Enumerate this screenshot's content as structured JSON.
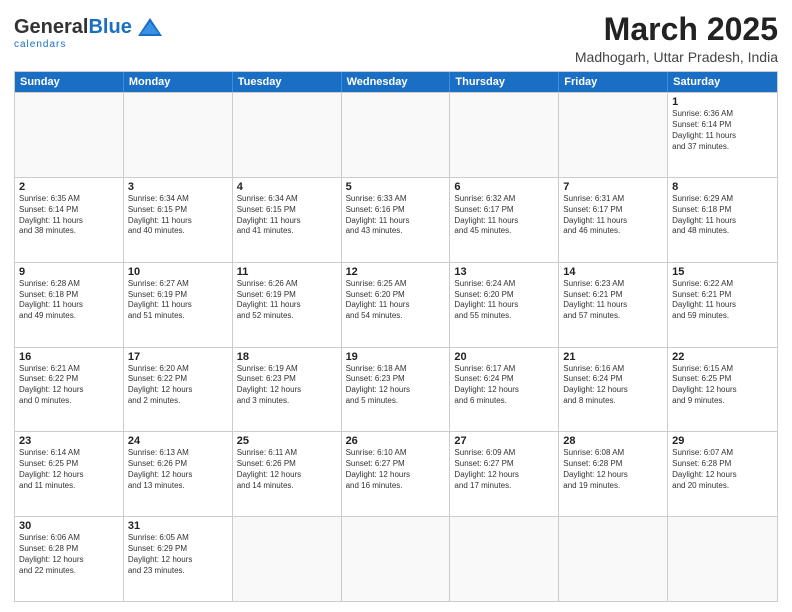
{
  "logo": {
    "general": "General",
    "blue": "Blue",
    "subtitle": "calendars"
  },
  "title": "March 2025",
  "subtitle": "Madhogarh, Uttar Pradesh, India",
  "header_days": [
    "Sunday",
    "Monday",
    "Tuesday",
    "Wednesday",
    "Thursday",
    "Friday",
    "Saturday"
  ],
  "weeks": [
    [
      {
        "day": "",
        "info": ""
      },
      {
        "day": "",
        "info": ""
      },
      {
        "day": "",
        "info": ""
      },
      {
        "day": "",
        "info": ""
      },
      {
        "day": "",
        "info": ""
      },
      {
        "day": "",
        "info": ""
      },
      {
        "day": "1",
        "info": "Sunrise: 6:36 AM\nSunset: 6:14 PM\nDaylight: 11 hours\nand 37 minutes."
      }
    ],
    [
      {
        "day": "2",
        "info": "Sunrise: 6:35 AM\nSunset: 6:14 PM\nDaylight: 11 hours\nand 38 minutes."
      },
      {
        "day": "3",
        "info": "Sunrise: 6:34 AM\nSunset: 6:15 PM\nDaylight: 11 hours\nand 40 minutes."
      },
      {
        "day": "4",
        "info": "Sunrise: 6:34 AM\nSunset: 6:15 PM\nDaylight: 11 hours\nand 41 minutes."
      },
      {
        "day": "5",
        "info": "Sunrise: 6:33 AM\nSunset: 6:16 PM\nDaylight: 11 hours\nand 43 minutes."
      },
      {
        "day": "6",
        "info": "Sunrise: 6:32 AM\nSunset: 6:17 PM\nDaylight: 11 hours\nand 45 minutes."
      },
      {
        "day": "7",
        "info": "Sunrise: 6:31 AM\nSunset: 6:17 PM\nDaylight: 11 hours\nand 46 minutes."
      },
      {
        "day": "8",
        "info": "Sunrise: 6:29 AM\nSunset: 6:18 PM\nDaylight: 11 hours\nand 48 minutes."
      }
    ],
    [
      {
        "day": "9",
        "info": "Sunrise: 6:28 AM\nSunset: 6:18 PM\nDaylight: 11 hours\nand 49 minutes."
      },
      {
        "day": "10",
        "info": "Sunrise: 6:27 AM\nSunset: 6:19 PM\nDaylight: 11 hours\nand 51 minutes."
      },
      {
        "day": "11",
        "info": "Sunrise: 6:26 AM\nSunset: 6:19 PM\nDaylight: 11 hours\nand 52 minutes."
      },
      {
        "day": "12",
        "info": "Sunrise: 6:25 AM\nSunset: 6:20 PM\nDaylight: 11 hours\nand 54 minutes."
      },
      {
        "day": "13",
        "info": "Sunrise: 6:24 AM\nSunset: 6:20 PM\nDaylight: 11 hours\nand 55 minutes."
      },
      {
        "day": "14",
        "info": "Sunrise: 6:23 AM\nSunset: 6:21 PM\nDaylight: 11 hours\nand 57 minutes."
      },
      {
        "day": "15",
        "info": "Sunrise: 6:22 AM\nSunset: 6:21 PM\nDaylight: 11 hours\nand 59 minutes."
      }
    ],
    [
      {
        "day": "16",
        "info": "Sunrise: 6:21 AM\nSunset: 6:22 PM\nDaylight: 12 hours\nand 0 minutes."
      },
      {
        "day": "17",
        "info": "Sunrise: 6:20 AM\nSunset: 6:22 PM\nDaylight: 12 hours\nand 2 minutes."
      },
      {
        "day": "18",
        "info": "Sunrise: 6:19 AM\nSunset: 6:23 PM\nDaylight: 12 hours\nand 3 minutes."
      },
      {
        "day": "19",
        "info": "Sunrise: 6:18 AM\nSunset: 6:23 PM\nDaylight: 12 hours\nand 5 minutes."
      },
      {
        "day": "20",
        "info": "Sunrise: 6:17 AM\nSunset: 6:24 PM\nDaylight: 12 hours\nand 6 minutes."
      },
      {
        "day": "21",
        "info": "Sunrise: 6:16 AM\nSunset: 6:24 PM\nDaylight: 12 hours\nand 8 minutes."
      },
      {
        "day": "22",
        "info": "Sunrise: 6:15 AM\nSunset: 6:25 PM\nDaylight: 12 hours\nand 9 minutes."
      }
    ],
    [
      {
        "day": "23",
        "info": "Sunrise: 6:14 AM\nSunset: 6:25 PM\nDaylight: 12 hours\nand 11 minutes."
      },
      {
        "day": "24",
        "info": "Sunrise: 6:13 AM\nSunset: 6:26 PM\nDaylight: 12 hours\nand 13 minutes."
      },
      {
        "day": "25",
        "info": "Sunrise: 6:11 AM\nSunset: 6:26 PM\nDaylight: 12 hours\nand 14 minutes."
      },
      {
        "day": "26",
        "info": "Sunrise: 6:10 AM\nSunset: 6:27 PM\nDaylight: 12 hours\nand 16 minutes."
      },
      {
        "day": "27",
        "info": "Sunrise: 6:09 AM\nSunset: 6:27 PM\nDaylight: 12 hours\nand 17 minutes."
      },
      {
        "day": "28",
        "info": "Sunrise: 6:08 AM\nSunset: 6:28 PM\nDaylight: 12 hours\nand 19 minutes."
      },
      {
        "day": "29",
        "info": "Sunrise: 6:07 AM\nSunset: 6:28 PM\nDaylight: 12 hours\nand 20 minutes."
      }
    ],
    [
      {
        "day": "30",
        "info": "Sunrise: 6:06 AM\nSunset: 6:28 PM\nDaylight: 12 hours\nand 22 minutes."
      },
      {
        "day": "31",
        "info": "Sunrise: 6:05 AM\nSunset: 6:29 PM\nDaylight: 12 hours\nand 23 minutes."
      },
      {
        "day": "",
        "info": ""
      },
      {
        "day": "",
        "info": ""
      },
      {
        "day": "",
        "info": ""
      },
      {
        "day": "",
        "info": ""
      },
      {
        "day": "",
        "info": ""
      }
    ]
  ]
}
